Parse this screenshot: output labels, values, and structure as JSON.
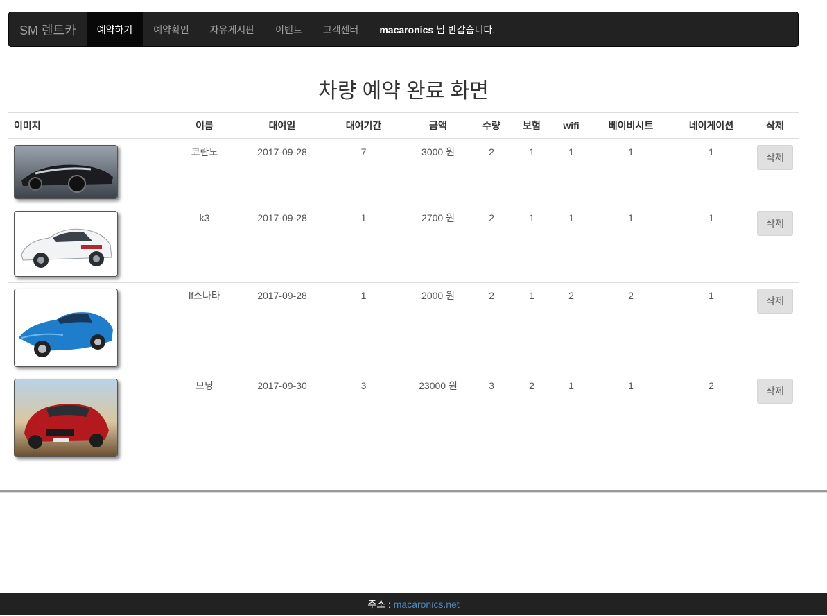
{
  "navbar": {
    "brand": "SM 렌트카",
    "items": [
      {
        "label": "예약하기",
        "active": true
      },
      {
        "label": "예약확인",
        "active": false
      },
      {
        "label": "자유게시판",
        "active": false
      },
      {
        "label": "이벤트",
        "active": false
      },
      {
        "label": "고객센터",
        "active": false
      }
    ],
    "user_name": "macaronics",
    "greeting_suffix": "님 반갑습니다."
  },
  "page_title": "차량 예약 완료 화면",
  "table": {
    "headers": [
      "이미지",
      "이름",
      "대여일",
      "대여기간",
      "금액",
      "수량",
      "보험",
      "wifi",
      "베이비시트",
      "네이게이션",
      "삭제"
    ],
    "rows": [
      {
        "image": "concept-car-image",
        "name": "코란도",
        "date": "2017-09-28",
        "period": "7",
        "price": "3000 원",
        "qty": "2",
        "insurance": "1",
        "wifi": "1",
        "babyseat": "1",
        "navigation": "1",
        "delete_label": "삭제"
      },
      {
        "image": "white-sedan-image",
        "name": "k3",
        "date": "2017-09-28",
        "period": "1",
        "price": "2700 원",
        "qty": "2",
        "insurance": "1",
        "wifi": "1",
        "babyseat": "1",
        "navigation": "1",
        "delete_label": "삭제"
      },
      {
        "image": "blue-sports-car-image",
        "name": "lf소나타",
        "date": "2017-09-28",
        "period": "1",
        "price": "2000 원",
        "qty": "2",
        "insurance": "1",
        "wifi": "2",
        "babyseat": "2",
        "navigation": "1",
        "delete_label": "삭제"
      },
      {
        "image": "red-hatchback-image",
        "name": "모닝",
        "date": "2017-09-30",
        "period": "3",
        "price": "23000 원",
        "qty": "3",
        "insurance": "2",
        "wifi": "1",
        "babyseat": "1",
        "navigation": "2",
        "delete_label": "삭제"
      }
    ]
  },
  "footer": {
    "address_label": "주소 : ",
    "address_link": "macaronics.net"
  },
  "colors": {
    "navbar_bg": "#222222",
    "active_bg": "#080808",
    "link": "#428bca"
  }
}
